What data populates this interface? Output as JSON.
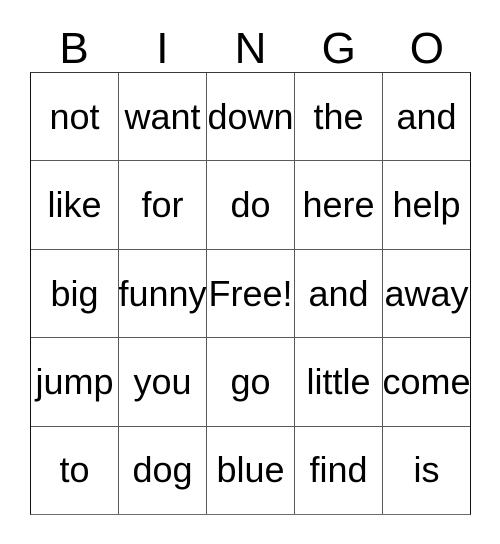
{
  "card": {
    "headers": [
      "B",
      "I",
      "N",
      "G",
      "O"
    ],
    "rows": [
      [
        "not",
        "want",
        "down",
        "the",
        "and"
      ],
      [
        "like",
        "for",
        "do",
        "here",
        "help"
      ],
      [
        "big",
        "funny",
        "Free!",
        "and",
        "away"
      ],
      [
        "jump",
        "you",
        "go",
        "little",
        "come"
      ],
      [
        "to",
        "dog",
        "blue",
        "find",
        "is"
      ]
    ],
    "free_space": "Free!",
    "free_space_position": {
      "row": 2,
      "column": 2
    },
    "grid_size": "5x5",
    "colors": {
      "background": "#ffffff",
      "text": "#000000",
      "grid_line": "#5a5a5a",
      "outer_border": "#111111"
    }
  }
}
